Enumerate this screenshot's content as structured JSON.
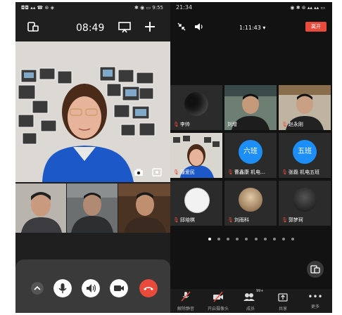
{
  "left": {
    "status": {
      "left": "◘◘ ▴▴ ☎ ⊛ ◈",
      "right": "✱ ◉ ▭ 9:55"
    },
    "header": {
      "time": "08:49"
    },
    "controls": [
      "chevron-up",
      "mic",
      "speaker",
      "camera",
      "hangup"
    ]
  },
  "right": {
    "status": {
      "time": "21:34",
      "right": "◉ ✱ ⊛ ▴▴ ▴▴ ▭"
    },
    "header": {
      "duration": "1:11:43",
      "duration_caret": "▾",
      "leave": "离开"
    },
    "participants": [
      {
        "name": "李帅",
        "muted": true
      },
      {
        "name": "刘增",
        "muted": false
      },
      {
        "name": "赵永刚",
        "muted": true
      },
      {
        "name": "潘爱民",
        "muted": true
      },
      {
        "name": "曹鑫康 机电...",
        "muted": true,
        "avatar_text": "六班"
      },
      {
        "name": "张磊 机电五班",
        "muted": true,
        "avatar_text": "五班"
      },
      {
        "name": "邱培棋",
        "muted": true
      },
      {
        "name": "刘雨科",
        "muted": true
      },
      {
        "name": "郭梦珂",
        "muted": true
      }
    ],
    "pages": 10,
    "active_page": 0,
    "toolbar": [
      {
        "label": "解除静音",
        "icon": "mic-muted-icon",
        "glyph": "🎙"
      },
      {
        "label": "开启摄像头",
        "icon": "camera-off-icon",
        "glyph": "📹"
      },
      {
        "label": "成员",
        "icon": "members-icon",
        "glyph": "👥",
        "badge": "99+"
      },
      {
        "label": "共享",
        "icon": "share-icon",
        "glyph": "⬆"
      },
      {
        "label": "更多",
        "icon": "more-icon",
        "glyph": "•••"
      }
    ]
  },
  "colors": {
    "accent_red": "#e84a3c",
    "accent_blue": "#1e8ef7"
  }
}
